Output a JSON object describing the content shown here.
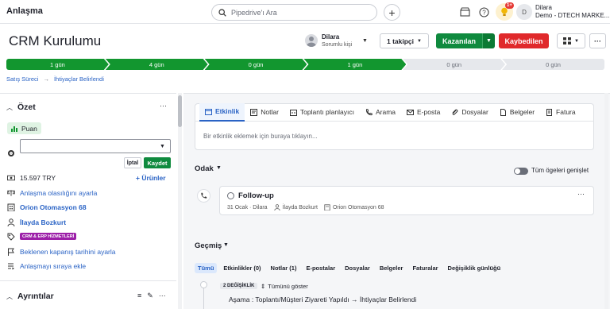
{
  "topbar": {
    "title": "Anlaşma",
    "search_placeholder": "Pipedrive'ı Ara",
    "add_label": "+",
    "notifications_badge": "1+",
    "avatar_initial": "D",
    "user_name": "Dilara",
    "user_company": "Demo - DTECH MARKE..."
  },
  "header": {
    "title": "CRM Kurulumu",
    "owner_name": "Dilara",
    "owner_role": "Sorumlu kişi",
    "follow_label": "1 takipçi",
    "won_label": "Kazanılan",
    "lost_label": "Kaybedilen",
    "more_label": "···"
  },
  "pipeline": {
    "stages": [
      {
        "label": "1 gün",
        "state": "done"
      },
      {
        "label": "4 gün",
        "state": "done"
      },
      {
        "label": "0 gün",
        "state": "done"
      },
      {
        "label": "1 gün",
        "state": "done"
      },
      {
        "label": "0 gün",
        "state": "todo"
      },
      {
        "label": "0 gün",
        "state": "todo"
      }
    ]
  },
  "breadcrumb": {
    "pipeline": "Satış Süreci",
    "sep": "→",
    "stage": "İhtiyaçlar Belirlendi"
  },
  "summary": {
    "title": "Özet",
    "more": "···",
    "score_label": "Puan",
    "cancel_label": "İptal",
    "save_label": "Kaydet",
    "amount": "15.597 TRY",
    "products_label": "+ Ürünler",
    "probability_link": "Anlaşma olasılığını ayarla",
    "organization": "Orion Otomasyon 68",
    "person": "İlayda Bozkurt",
    "tag": "CRM & ERP HİZMETLERİ",
    "close_date_link": "Beklenen kapanış tarihini ayarla",
    "sequence_link": "Anlaşmayı sıraya ekle"
  },
  "details": {
    "title": "Ayrıntılar"
  },
  "composer": {
    "tabs": [
      {
        "label": "Etkinlik",
        "icon": "calendar-icon",
        "active": true
      },
      {
        "label": "Notlar",
        "icon": "note-icon",
        "active": false
      },
      {
        "label": "Toplantı planlayıcı",
        "icon": "scheduler-icon",
        "active": false
      },
      {
        "label": "Arama",
        "icon": "phone-icon",
        "active": false
      },
      {
        "label": "E-posta",
        "icon": "mail-icon",
        "active": false
      },
      {
        "label": "Dosyalar",
        "icon": "paperclip-icon",
        "active": false
      },
      {
        "label": "Belgeler",
        "icon": "document-icon",
        "active": false
      },
      {
        "label": "Fatura",
        "icon": "invoice-icon",
        "active": false
      }
    ],
    "placeholder": "Bir etkinlik eklemek için buraya tıklayın..."
  },
  "focus": {
    "title": "Odak",
    "toggle_label": "Tüm ögeleri genişlet",
    "card_title": "Follow-up",
    "card_date": "31 Ocak · Dilara",
    "card_person": "İlayda Bozkurt",
    "card_org": "Orion Otomasyon 68"
  },
  "history": {
    "title": "Geçmiş",
    "filters": [
      {
        "label": "Tümü",
        "active": true
      },
      {
        "label": "Etkinlikler (0)",
        "active": false
      },
      {
        "label": "Notlar (1)",
        "active": false
      },
      {
        "label": "E-postalar",
        "active": false
      },
      {
        "label": "Dosyalar",
        "active": false
      },
      {
        "label": "Belgeler",
        "active": false
      },
      {
        "label": "Faturalar",
        "active": false
      },
      {
        "label": "Değişiklik günlüğü",
        "active": false
      }
    ],
    "changes_badge": "2 DEĞİŞİKLİK",
    "show_all": "Tümünü göster",
    "change_text": "Aşama : Toplantı/Müşteri Ziyareti Yapıldı → İhtiyaçlar Belirlendi"
  },
  "colors": {
    "green": "#0f8a3e",
    "red": "#e0292b",
    "link": "#2a63c5",
    "tag": "#9c1fa8"
  }
}
